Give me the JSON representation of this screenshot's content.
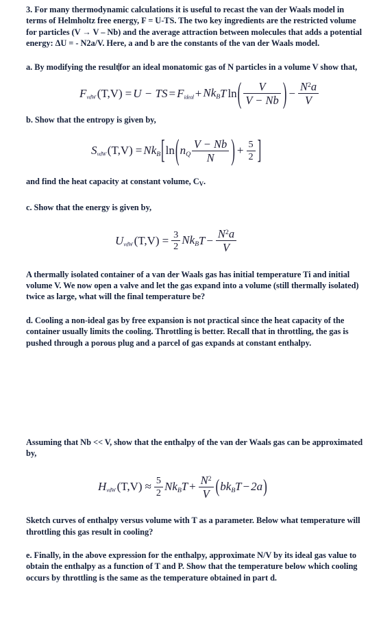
{
  "document": {
    "type": "physics-homework-problem",
    "problem_number": "3.",
    "paragraphs": {
      "intro": "3.  For many thermodynamic calculations it is useful to recast the van der Waals model in terms of Helmholtz free energy, F = U-TS.   The two key ingredients are the restricted volume for particles (V → V – Nb) and the average attraction between molecules that adds a potential energy:   ΔU = - N2a/V.  Here, a and b are the constants of the van der Waals model.",
      "part_a_before_caret": "a. By modifying the result",
      "part_a_after_caret": "for an ideal monatomic gas of N particles in a volume V show that,",
      "part_b": "b. Show that the entropy is given by,",
      "heat_capacity": "and find the heat capacity at constant volume, CV.",
      "part_c": "c. Show that the energy is given by,",
      "isolated_container": "A thermally isolated container of a van der Waals gas has initial temperature Ti and initial volume V.   We now open a valve and let the gas expand into a volume (still thermally isolated) twice as large, what will the final temperature be?",
      "part_d": "d. Cooling a non-ideal gas by free expansion is not practical since the heat capacity of the container usually limits the cooling.  Throttling is better.  Recall that in throttling, the gas is pushed through a porous plug and a parcel of gas expands at constant enthalpy.",
      "assuming": "Assuming that Nb << V, show that the enthalpy of the van der Waals gas can be approximated by,",
      "sketch": "Sketch curves of enthalpy versus volume with T as a parameter.  Below what temperature will throttling this gas result in cooling?",
      "part_e": "e.  Finally, in the above expression for the enthalpy, approximate N/V by its ideal gas value to obtain the enthalpy as a function of T and P.  Show that the temperature below which cooling occurs by throttling is the same as the temperature obtained in part d."
    },
    "equations": {
      "helmholtz": {
        "id": "eq-helmholtz-free-energy",
        "latex": "F_{vdW}(T,V) = U - TS = F_{ideal} + Nk_BT\\ln\\left(\\frac{V}{V-Nb}\\right) - \\frac{N^2a}{V}",
        "plain": "F_vdW (T,V) = U - TS = F_ideal + Nk_B T ln( V / (V - Nb) ) - N^2 a / V",
        "tokens": {
          "lhs_symbol": "F",
          "lhs_subscript": "vdW",
          "args": "(T,V)",
          "equals": "=",
          "u_minus_ts": "U − TS",
          "f_ideal_symbol": "F",
          "f_ideal_subscript": "ideal",
          "plus": "+",
          "nkbt": "Nk",
          "kb_subscript": "B",
          "t": "T",
          "ln": "ln",
          "frac_num": "V",
          "frac_den": "V − Nb",
          "minus": "−",
          "last_num_n": "N",
          "last_num_sup": "2",
          "last_num_a": "a",
          "last_den": "V"
        }
      },
      "entropy": {
        "id": "eq-entropy",
        "latex": "S_{vdW}(T,V) = Nk_B\\left[\\ln\\left(n_Q\\frac{V-Nb}{N}\\right)+\\frac{5}{2}\\right]",
        "plain": "S_vdW (T,V) = Nk_B [ ln( n_Q (V - Nb)/N ) + 5/2 ]",
        "tokens": {
          "lhs_symbol": "S",
          "lhs_subscript": "vdW",
          "args": "(T,V)",
          "equals": "=",
          "nkb": "Nk",
          "kb_subscript": "B",
          "ln": "ln",
          "nq_symbol": "n",
          "nq_subscript": "Q",
          "frac_num": "V − Nb",
          "frac_den": "N",
          "plus": "+",
          "five": "5",
          "two": "2"
        }
      },
      "energy": {
        "id": "eq-energy",
        "latex": "U_{vdW}(T,V) = \\frac{3}{2}Nk_BT - \\frac{N^2a}{V}",
        "plain": "U_vdW (T,V) = (3/2) Nk_B T - N^2 a / V",
        "tokens": {
          "lhs_symbol": "U",
          "lhs_subscript": "vdW",
          "args": "(T,V)",
          "equals": "=",
          "three": "3",
          "two": "2",
          "nkbt": "Nk",
          "kb_subscript": "B",
          "t": "T",
          "minus": "−",
          "num_n": "N",
          "num_sup": "2",
          "num_a": "a",
          "den": "V"
        }
      },
      "enthalpy": {
        "id": "eq-enthalpy",
        "latex": "H_{vdW}(T,V) \\approx \\frac{5}{2}Nk_BT + \\frac{N^2}{V}\\left(bk_BT - 2a\\right)",
        "plain": "H_vdW (T,V) ≈ (5/2) Nk_B T + (N^2/V)(b k_B T - 2a)",
        "tokens": {
          "lhs_symbol": "H",
          "lhs_subscript": "vdW",
          "args": "(T,V)",
          "approx": "≈",
          "five": "5",
          "two": "2",
          "nkbt": "Nk",
          "kb_subscript": "B",
          "t": "T",
          "plus": "+",
          "frac_num_n": "N",
          "frac_num_sup": "2",
          "frac_den": "V",
          "paren_open": "(",
          "b": "bk",
          "b_sub": "B",
          "b_t": "T",
          "minus": "−",
          "two_a": "2a",
          "paren_close": ")"
        }
      }
    },
    "colors": {
      "text": "#16213a",
      "math": "#1b1b32",
      "background": "#ffffff",
      "caret": "#12121f"
    },
    "caret": {
      "present": true,
      "after_text": "result"
    }
  }
}
